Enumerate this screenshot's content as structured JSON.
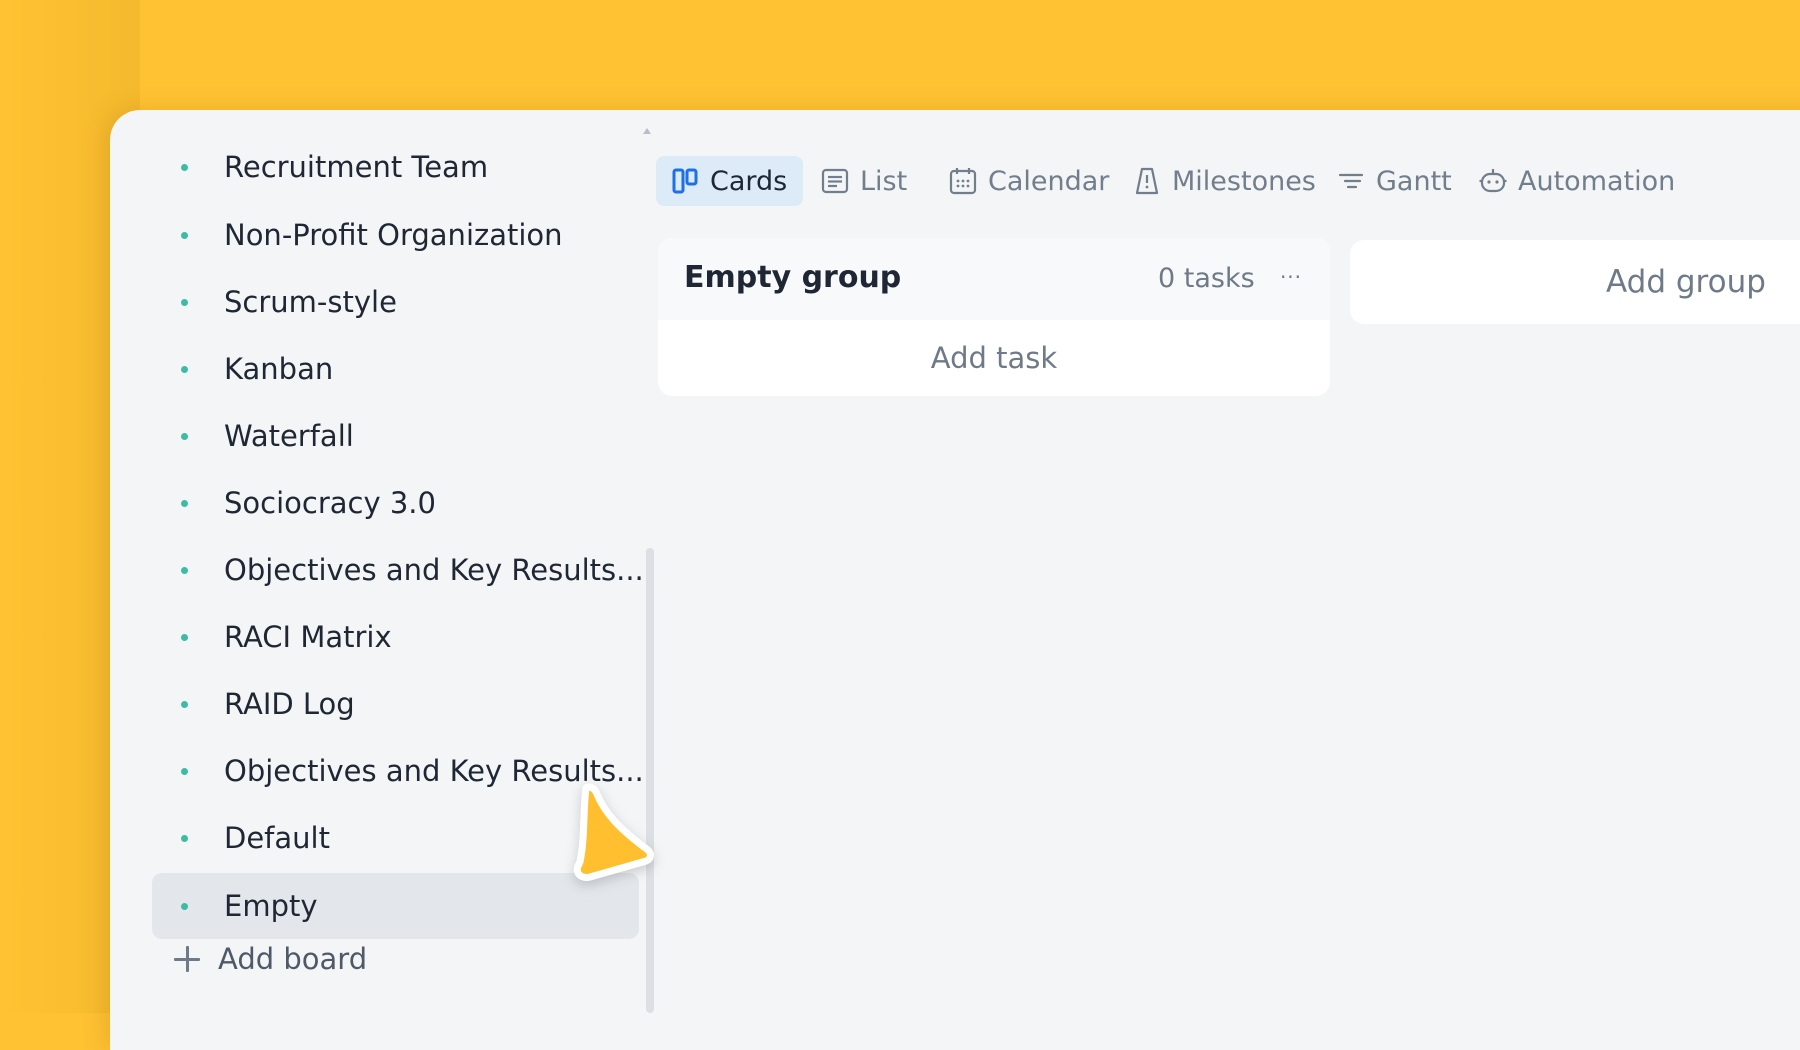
{
  "sidebar": {
    "boards": [
      {
        "label": "Recruitment Team"
      },
      {
        "label": "Non-Profit Organization"
      },
      {
        "label": "Scrum-style"
      },
      {
        "label": "Kanban"
      },
      {
        "label": "Waterfall"
      },
      {
        "label": "Sociocracy 3.0"
      },
      {
        "label": "Objectives and Key Results..."
      },
      {
        "label": "RACI Matrix"
      },
      {
        "label": "RAID Log"
      },
      {
        "label": "Objectives and Key Results..."
      },
      {
        "label": "Default"
      },
      {
        "label": "Empty",
        "active": true
      }
    ],
    "add_board_label": "Add board"
  },
  "tabs": [
    {
      "label": "Cards",
      "icon": "cards-icon",
      "active": true
    },
    {
      "label": "List",
      "icon": "list-icon"
    },
    {
      "label": "Calendar",
      "icon": "calendar-icon"
    },
    {
      "label": "Milestones",
      "icon": "milestones-icon"
    },
    {
      "label": "Gantt",
      "icon": "gantt-icon"
    },
    {
      "label": "Automation",
      "icon": "automation-icon"
    }
  ],
  "group": {
    "title": "Empty group",
    "count": "0 tasks",
    "menu": "···",
    "add_task_label": "Add task"
  },
  "add_group_label": "Add group",
  "colors": {
    "background": "#FFC233",
    "accent_blue": "#1F6FE5",
    "dot_teal": "#3DBBA4",
    "active_tab_bg": "#DDEBF8"
  }
}
